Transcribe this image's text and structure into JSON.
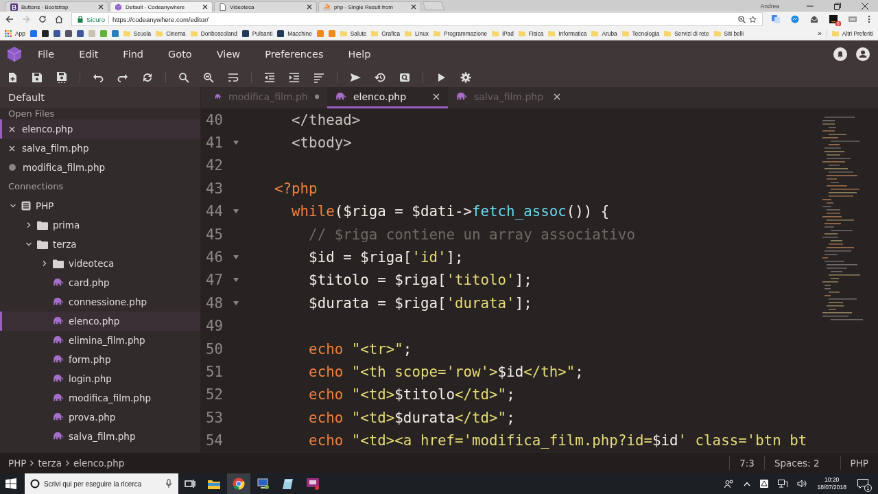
{
  "browser": {
    "tabs": [
      {
        "title": "Buttons · Bootstrap",
        "kind": "bootstrap",
        "selected": false
      },
      {
        "title": "Default - Codeanywhere",
        "kind": "codeanywhere",
        "selected": true
      },
      {
        "title": "Videoteca",
        "kind": "page",
        "selected": false
      },
      {
        "title": "php - Single Result from",
        "kind": "stack",
        "selected": false
      }
    ],
    "user": "Andrea",
    "address": {
      "security": "Sicuro",
      "url": "https://codeanywhere.com/editor/"
    },
    "extension_badge": "6",
    "bookmarks": [
      {
        "kind": "apps",
        "label": "App"
      },
      {
        "kind": "site",
        "color": "#1a73e8"
      },
      {
        "kind": "site",
        "color": "#222222"
      },
      {
        "kind": "site",
        "color": "#3b5998"
      },
      {
        "kind": "site",
        "color": "#555566"
      },
      {
        "kind": "site",
        "color": "#3b5998"
      },
      {
        "kind": "site",
        "color": "#c9c2b0"
      },
      {
        "kind": "site",
        "color": "#5fb336"
      },
      {
        "kind": "site",
        "color": "#2a7fb8"
      },
      {
        "kind": "folder",
        "label": "Scuola"
      },
      {
        "kind": "folder",
        "label": "Cinema"
      },
      {
        "kind": "folder",
        "label": "Donboscoland"
      },
      {
        "kind": "site",
        "color": "#1f3a5a",
        "label": "Pulsanti"
      },
      {
        "kind": "site",
        "color": "#1f3a5a",
        "label": "Macchine"
      },
      {
        "kind": "site",
        "color": "#f08a1c"
      },
      {
        "kind": "site",
        "color": "#f08a1c"
      },
      {
        "kind": "folder",
        "label": "Salute"
      },
      {
        "kind": "folder",
        "label": "Grafica"
      },
      {
        "kind": "folder",
        "label": "Linux"
      },
      {
        "kind": "folder",
        "label": "Programmazione"
      },
      {
        "kind": "folder",
        "label": "iPad"
      },
      {
        "kind": "folder",
        "label": "Fisica"
      },
      {
        "kind": "folder",
        "label": "Informatica"
      },
      {
        "kind": "folder",
        "label": "Aruba"
      },
      {
        "kind": "folder",
        "label": "Tecnologia"
      },
      {
        "kind": "folder",
        "label": "Servizi di rete"
      },
      {
        "kind": "folder",
        "label": "Siti belli"
      }
    ],
    "bookmarks_more": "»",
    "other_bookmarks": "Altri Preferiti"
  },
  "menu": [
    "File",
    "Edit",
    "Find",
    "Goto",
    "View",
    "Preferences",
    "Help"
  ],
  "sidebar": {
    "title": "Default",
    "open_files_label": "Open Files",
    "open_files": [
      {
        "name": "elenco.php",
        "selected": true,
        "modified": false
      },
      {
        "name": "salva_film.php",
        "selected": false,
        "modified": false
      },
      {
        "name": "modifica_film.php",
        "selected": false,
        "modified": true
      }
    ],
    "connections_label": "Connections",
    "tree": [
      {
        "name": "PHP",
        "kind": "server",
        "expanded": true,
        "selected": false,
        "children": [
          {
            "name": "prima",
            "kind": "folder",
            "expanded": false,
            "selected": false
          },
          {
            "name": "terza",
            "kind": "folder",
            "expanded": true,
            "selected": false,
            "children": [
              {
                "name": "videoteca",
                "kind": "folder",
                "expanded": false,
                "selected": false
              },
              {
                "name": "card.php",
                "kind": "file",
                "selected": false
              },
              {
                "name": "connessione.php",
                "kind": "file",
                "selected": false
              },
              {
                "name": "elenco.php",
                "kind": "file",
                "selected": true
              },
              {
                "name": "elimina_film.php",
                "kind": "file",
                "selected": false
              },
              {
                "name": "form.php",
                "kind": "file",
                "selected": false
              },
              {
                "name": "login.php",
                "kind": "file",
                "selected": false
              },
              {
                "name": "modifica_film.php",
                "kind": "file",
                "selected": false
              },
              {
                "name": "prova.php",
                "kind": "file",
                "selected": false
              },
              {
                "name": "salva_film.php",
                "kind": "file",
                "selected": false
              }
            ]
          }
        ]
      }
    ]
  },
  "editor_tabs": [
    {
      "name": "modifica_film.ph",
      "selected": false,
      "modified": true
    },
    {
      "name": "elenco.php",
      "selected": true,
      "modified": false
    },
    {
      "name": "salva_film.php",
      "selected": false,
      "modified": false
    }
  ],
  "code": [
    {
      "number": "40",
      "foldable": false,
      "tokens": [
        {
          "kind": "tag",
          "text": "    </thead>"
        }
      ]
    },
    {
      "number": "41",
      "foldable": true,
      "tokens": [
        {
          "kind": "tag",
          "text": "    <tbody>"
        }
      ]
    },
    {
      "number": "42",
      "foldable": false
    },
    {
      "number": "43",
      "foldable": false,
      "tokens": [
        {
          "kind": "keyword",
          "text": "  <?php"
        }
      ]
    },
    {
      "number": "44",
      "foldable": true,
      "tokens": [
        {
          "kind": "keyword",
          "text": "    while"
        },
        {
          "kind": "plain",
          "text": "($riga = $dati->"
        },
        {
          "kind": "function",
          "text": "fetch_assoc"
        },
        {
          "kind": "plain",
          "text": "()) {"
        }
      ]
    },
    {
      "number": "45",
      "foldable": false,
      "tokens": [
        {
          "kind": "comment",
          "text": "      // $riga contiene un array associativo"
        }
      ]
    },
    {
      "number": "46",
      "foldable": true,
      "tokens": [
        {
          "kind": "plain",
          "text": "      $id = $riga["
        },
        {
          "kind": "string",
          "text": "'id'"
        },
        {
          "kind": "plain",
          "text": "];"
        }
      ]
    },
    {
      "number": "47",
      "foldable": true,
      "tokens": [
        {
          "kind": "plain",
          "text": "      $titolo = $riga["
        },
        {
          "kind": "string",
          "text": "'titolo'"
        },
        {
          "kind": "plain",
          "text": "];"
        }
      ]
    },
    {
      "number": "48",
      "foldable": true,
      "tokens": [
        {
          "kind": "plain",
          "text": "      $durata = $riga["
        },
        {
          "kind": "string",
          "text": "'durata'"
        },
        {
          "kind": "plain",
          "text": "];"
        }
      ]
    },
    {
      "number": "49",
      "foldable": false
    },
    {
      "number": "50",
      "foldable": false,
      "tokens": [
        {
          "kind": "keyword",
          "text": "      echo "
        },
        {
          "kind": "string",
          "text": "\"<tr>\""
        },
        {
          "kind": "plain",
          "text": ";"
        }
      ]
    },
    {
      "number": "51",
      "foldable": false,
      "tokens": [
        {
          "kind": "keyword",
          "text": "      echo "
        },
        {
          "kind": "string",
          "text": "\"<th scope='row'>"
        },
        {
          "kind": "plain",
          "text": "$id"
        },
        {
          "kind": "string",
          "text": "</th>\""
        },
        {
          "kind": "plain",
          "text": ";"
        }
      ]
    },
    {
      "number": "52",
      "foldable": false,
      "tokens": [
        {
          "kind": "keyword",
          "text": "      echo "
        },
        {
          "kind": "string",
          "text": "\"<td>"
        },
        {
          "kind": "plain",
          "text": "$titolo"
        },
        {
          "kind": "string",
          "text": "</td>\""
        },
        {
          "kind": "plain",
          "text": ";"
        }
      ]
    },
    {
      "number": "53",
      "foldable": false,
      "tokens": [
        {
          "kind": "keyword",
          "text": "      echo "
        },
        {
          "kind": "string",
          "text": "\"<td>"
        },
        {
          "kind": "plain",
          "text": "$durata"
        },
        {
          "kind": "string",
          "text": "</td>\""
        },
        {
          "kind": "plain",
          "text": ";"
        }
      ]
    },
    {
      "number": "54",
      "foldable": false,
      "tokens": [
        {
          "kind": "keyword",
          "text": "      echo "
        },
        {
          "kind": "string",
          "text": "\"<td><a href='modifica_film.php?id="
        },
        {
          "kind": "plain",
          "text": "$id"
        },
        {
          "kind": "string",
          "text": "' class='btn bt"
        }
      ]
    }
  ],
  "status_bar": {
    "breadcrumb": [
      "PHP",
      "terza",
      "elenco.php"
    ],
    "cursor": "7:3",
    "indent": "Spaces: 2",
    "language": "PHP"
  },
  "taskbar": {
    "search_placeholder": "Scrivi qui per eseguire la ricerca",
    "time": "10:20",
    "date": "18/07/2018",
    "notifications": "1"
  }
}
